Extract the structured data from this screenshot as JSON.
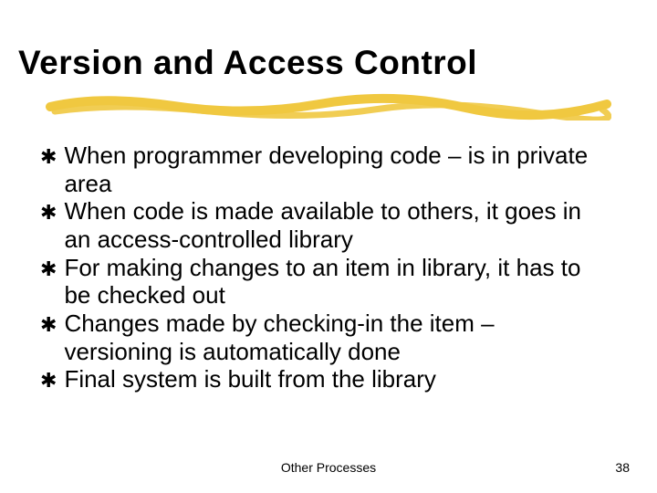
{
  "title": "Version and Access Control",
  "bullets": [
    "When programmer developing code – is in private area",
    "When code is made available to others, it goes in an access-controlled library",
    "For making changes to an item in library, it has to be checked out",
    "Changes made by checking-in the item – versioning is automatically done",
    "Final system is built from the library"
  ],
  "footer": {
    "center": "Other Processes",
    "number": "38"
  },
  "colors": {
    "underline": "#f0c840"
  }
}
